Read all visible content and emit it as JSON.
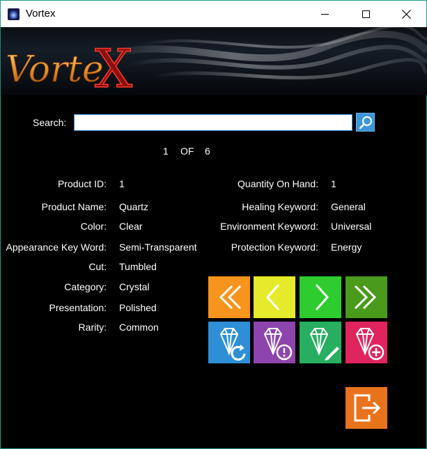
{
  "window": {
    "title": "Vortex",
    "icon": "vortex-app-icon"
  },
  "banner": {
    "logo_text": "VorteX"
  },
  "search": {
    "label": "Search:",
    "value": "",
    "placeholder": "",
    "button_icon": "search-icon"
  },
  "pager": {
    "current": "1",
    "of_label": "OF",
    "total": "6"
  },
  "fields_left": [
    {
      "label": "Product ID:",
      "value": "1"
    },
    {
      "label": "Product Name:",
      "value": "Quartz"
    },
    {
      "label": "Color:",
      "value": "Clear"
    },
    {
      "label": "Appearance Key Word:",
      "value": "Semi-Transparent"
    },
    {
      "label": "Cut:",
      "value": "Tumbled"
    },
    {
      "label": "Category:",
      "value": "Crystal"
    },
    {
      "label": "Presentation:",
      "value": "Polished"
    },
    {
      "label": "Rarity:",
      "value": "Common"
    }
  ],
  "fields_right": [
    {
      "label": "Quantity On Hand:",
      "value": "1"
    },
    {
      "label": "Healing Keyword:",
      "value": "General"
    },
    {
      "label": "Environment Keyword:",
      "value": "Universal"
    },
    {
      "label": "Protection Keyword:",
      "value": "Energy"
    }
  ],
  "nav_buttons": [
    {
      "name": "first-record-button",
      "icon": "double-chevron-left-icon",
      "color": "#f7941d"
    },
    {
      "name": "previous-record-button",
      "icon": "chevron-left-icon",
      "color": "#e5ea2a"
    },
    {
      "name": "next-record-button",
      "icon": "chevron-right-icon",
      "color": "#2ecc2e"
    },
    {
      "name": "last-record-button",
      "icon": "double-chevron-right-icon",
      "color": "#4a9a1c"
    }
  ],
  "action_buttons": [
    {
      "name": "refresh-crystal-button",
      "icon": "crystal-refresh-icon",
      "color": "#2e8fd6"
    },
    {
      "name": "crystal-alert-button",
      "icon": "crystal-alert-icon",
      "color": "#8e44ad"
    },
    {
      "name": "edit-crystal-button",
      "icon": "crystal-edit-icon",
      "color": "#27ae60"
    },
    {
      "name": "add-crystal-button",
      "icon": "crystal-add-icon",
      "color": "#e0245e"
    }
  ],
  "exit_button": {
    "icon": "exit-icon",
    "color": "#e8731c"
  }
}
